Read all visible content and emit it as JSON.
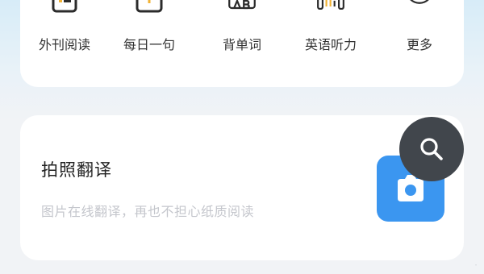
{
  "features": [
    {
      "label": "外刊阅读",
      "icon": "article-list-icon"
    },
    {
      "label": "每日一句",
      "icon": "daily-sentence-icon"
    },
    {
      "label": "背单词",
      "icon": "vocabulary-ab-icon"
    },
    {
      "label": "英语听力",
      "icon": "listening-audio-icon"
    },
    {
      "label": "更多",
      "icon": "more-circle-icon"
    }
  ],
  "photo_translate": {
    "title": "拍照翻译",
    "subtitle": "图片在线翻译，再也不担心纸质阅读",
    "camera_icon": "camera-icon",
    "accent_color": "#3b96f0"
  },
  "floating_search": {
    "icon": "search-icon",
    "color": "#41464c"
  },
  "watermark": {
    "text": "·"
  }
}
